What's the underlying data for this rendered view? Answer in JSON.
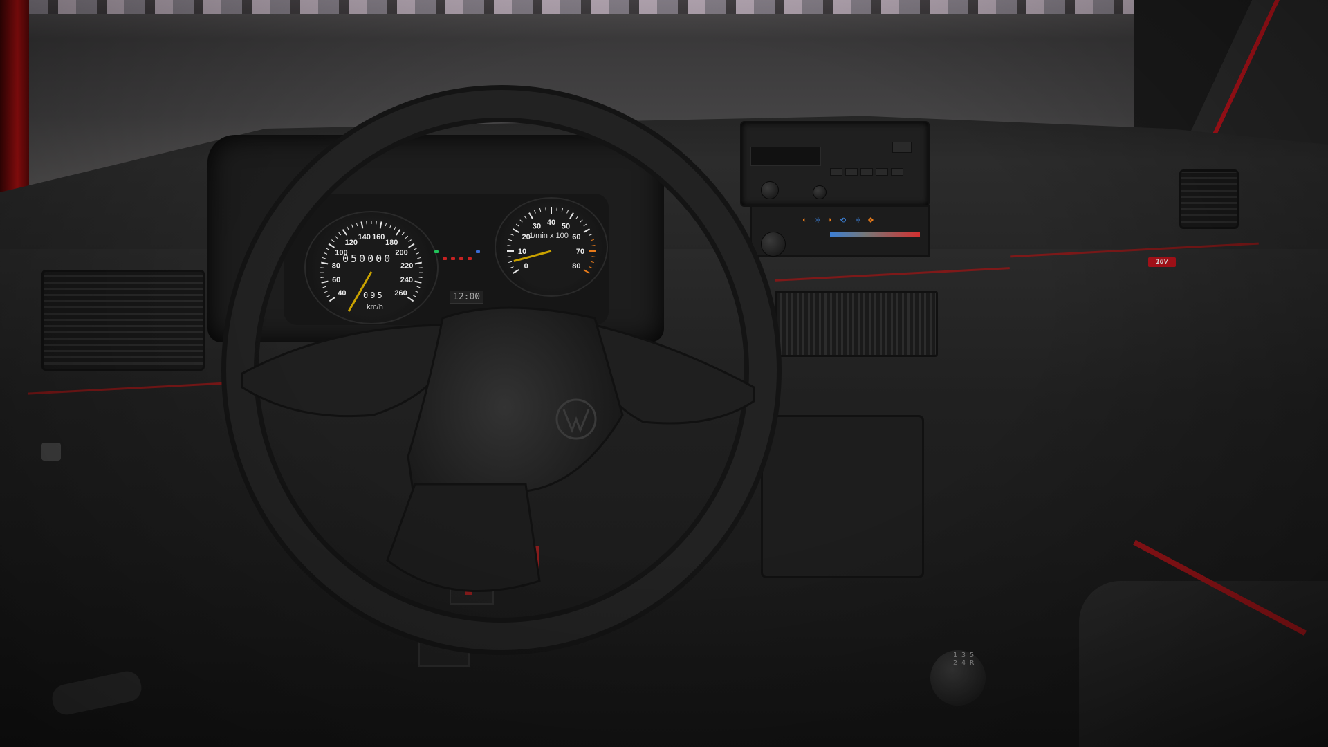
{
  "speedometer": {
    "labels": [
      "40",
      "60",
      "80",
      "100",
      "120",
      "140",
      "160",
      "180",
      "200",
      "220",
      "240",
      "260"
    ],
    "unit": "km/h",
    "odometer": "050000",
    "trip": "095"
  },
  "tachometer": {
    "labels": [
      "0",
      "10",
      "20",
      "30",
      "40",
      "50",
      "60",
      "70",
      "80"
    ],
    "unit": "1/min x 100"
  },
  "clock": "12:00",
  "badge": "16V",
  "shift_pattern": "1 3 5\n2 4 R",
  "colors": {
    "interior": "#1c1c1c",
    "accent_red": "#b0121a",
    "needle": "#c9a200",
    "climate_warm": "#e87b1a",
    "climate_cool": "#3b7fd6"
  }
}
